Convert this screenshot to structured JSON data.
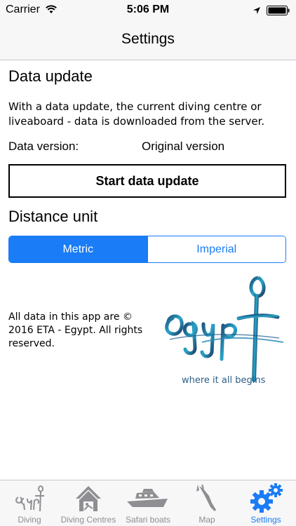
{
  "status_bar": {
    "carrier": "Carrier",
    "time": "5:06 PM"
  },
  "nav": {
    "title": "Settings"
  },
  "data_update": {
    "title": "Data update",
    "description": "With a data update, the current diving centre or liveaboard - data is downloaded from the server.",
    "version_label": "Data version:",
    "version_value": "Original version",
    "button_label": "Start data update"
  },
  "distance_unit": {
    "title": "Distance unit",
    "options": [
      "Metric",
      "Imperial"
    ],
    "selected": "Metric"
  },
  "footer": {
    "copyright": "All data in this app are © 2016 ETA - Egypt. All rights reserved.",
    "logo_text": "Egypt",
    "logo_tagline": "where it all begins"
  },
  "tabs": [
    {
      "label": "Diving",
      "icon": "egypt-logo-icon"
    },
    {
      "label": "Diving Centres",
      "icon": "house-icon"
    },
    {
      "label": "Safari boats",
      "icon": "boat-icon"
    },
    {
      "label": "Map",
      "icon": "map-icon"
    },
    {
      "label": "Settings",
      "icon": "gears-icon"
    }
  ],
  "colors": {
    "accent": "#1a7cf6",
    "inactive_tab": "#8e8e93",
    "bar_background": "#f7f7f7"
  }
}
